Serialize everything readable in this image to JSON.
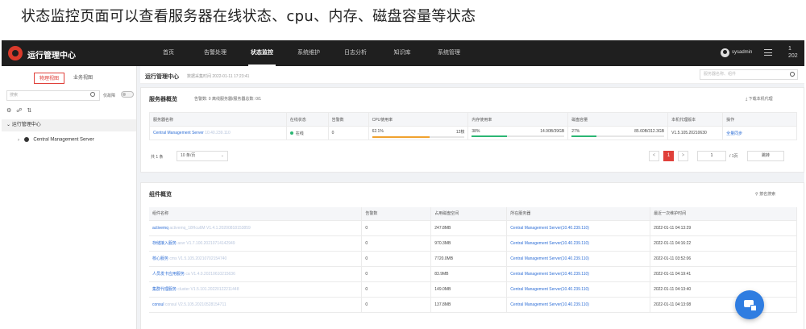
{
  "caption": "状态监控页面可以查看服务器在线状态、cpu、内存、磁盘容量等状态",
  "app": {
    "title": "运行管理中心"
  },
  "nav": {
    "items": [
      "首页",
      "告警处理",
      "状态监控",
      "系统维护",
      "日志分析",
      "知识库",
      "系统管理"
    ],
    "active": "状态监控"
  },
  "user": {
    "name": "sysadmin",
    "clock_line1": "1",
    "clock_line2": "202"
  },
  "sidebar": {
    "tabs": [
      "物理视图",
      "业务视图"
    ],
    "search_placeholder": "搜索",
    "toggle_label": "仅故障",
    "tree_root": "运行管理中心",
    "tree_child": "Central Management Server"
  },
  "main": {
    "breadcrumb_title": "运行管理中心",
    "refresh_time": "数据采集时间 2022-01-11 17:23:41",
    "search_placeholder": "服务器名称、组件"
  },
  "server_panel": {
    "title": "服务器概览",
    "stats": "告警数: 0   离线服务器/服务器总数: 0/1",
    "download": "下载本机代理",
    "columns": [
      "服务器名称",
      "在线状态",
      "告警数",
      "CPU使用率",
      "内存使用率",
      "磁盘容量",
      "本机代理版本",
      "操作"
    ],
    "row": {
      "name": "Central Management Server",
      "ip": "10.40.239.110",
      "status": "在线",
      "alarms": "0",
      "cpu_text": "62.1%",
      "cpu_cores": "12核",
      "cpu_pct": 62.1,
      "mem_text": "38%",
      "mem_detail": "14.90B/39GB",
      "mem_pct": 38,
      "disk_text": "27%",
      "disk_detail": "85.60B/312.3GB",
      "disk_pct": 27,
      "agent_version": "V1.5.105.20210630",
      "action": "全量同步"
    },
    "pager": {
      "total": "共 1 条",
      "page_size": "10 条/页",
      "prev": "<",
      "current": "1",
      "next": ">",
      "jump_value": "1",
      "of_pages": "/ 1页",
      "go": "跳转"
    }
  },
  "component_panel": {
    "title": "组件概览",
    "action": "按名搜索",
    "columns": [
      "组件名称",
      "告警数",
      "占用磁盘空间",
      "所在服务器",
      "最近一次维护时间"
    ],
    "rows": [
      {
        "name": "activemq",
        "tag": "activemq_18Hcu6M",
        "version": "V1.4.1.20200818153859",
        "alarms": "0",
        "disk": "247.8MB",
        "server": "Central Management Server(10.40.239.110)",
        "time": "2022-01-11 04:13:29"
      },
      {
        "name": "存储接入服务",
        "tag": "asvr",
        "version": "V1.7.100.20210714142949",
        "alarms": "0",
        "disk": "970.3MB",
        "server": "Central Management Server(10.40.239.110)",
        "time": "2022-01-11 04:16:22"
      },
      {
        "name": "核心服务",
        "tag": "cms",
        "version": "V1.5.105.20210702154740",
        "alarms": "0",
        "disk": "7720.0MB",
        "server": "Central Management Server(10.40.239.110)",
        "time": "2022-01-11 03:52:06"
      },
      {
        "name": "人员发卡应用服务",
        "tag": "ca",
        "version": "V1.4.0.20210610215636",
        "alarms": "0",
        "disk": "83.9MB",
        "server": "Central Management Server(10.40.239.110)",
        "time": "2022-01-11 04:19:41"
      },
      {
        "name": "集群代理服务",
        "tag": "cluster",
        "version": "V1.5.101.20220122211448",
        "alarms": "0",
        "disk": "149.0MB",
        "server": "Central Management Server(10.40.239.110)",
        "time": "2022-01-11 04:13:40"
      },
      {
        "name": "consul",
        "tag": "consul",
        "version": "V2.5.105.20210528154711",
        "alarms": "0",
        "disk": "137.8MB",
        "server": "Central Management Server(10.40.239.110)",
        "time": "2022-01-11 04:13:08"
      }
    ]
  },
  "colors": {
    "accent": "#e0403a",
    "cpu_bar": "#f0a22e",
    "mem_bar": "#2bb673",
    "disk_bar": "#2bb673",
    "link": "#2f6fd6",
    "fab": "#2f7de1"
  }
}
